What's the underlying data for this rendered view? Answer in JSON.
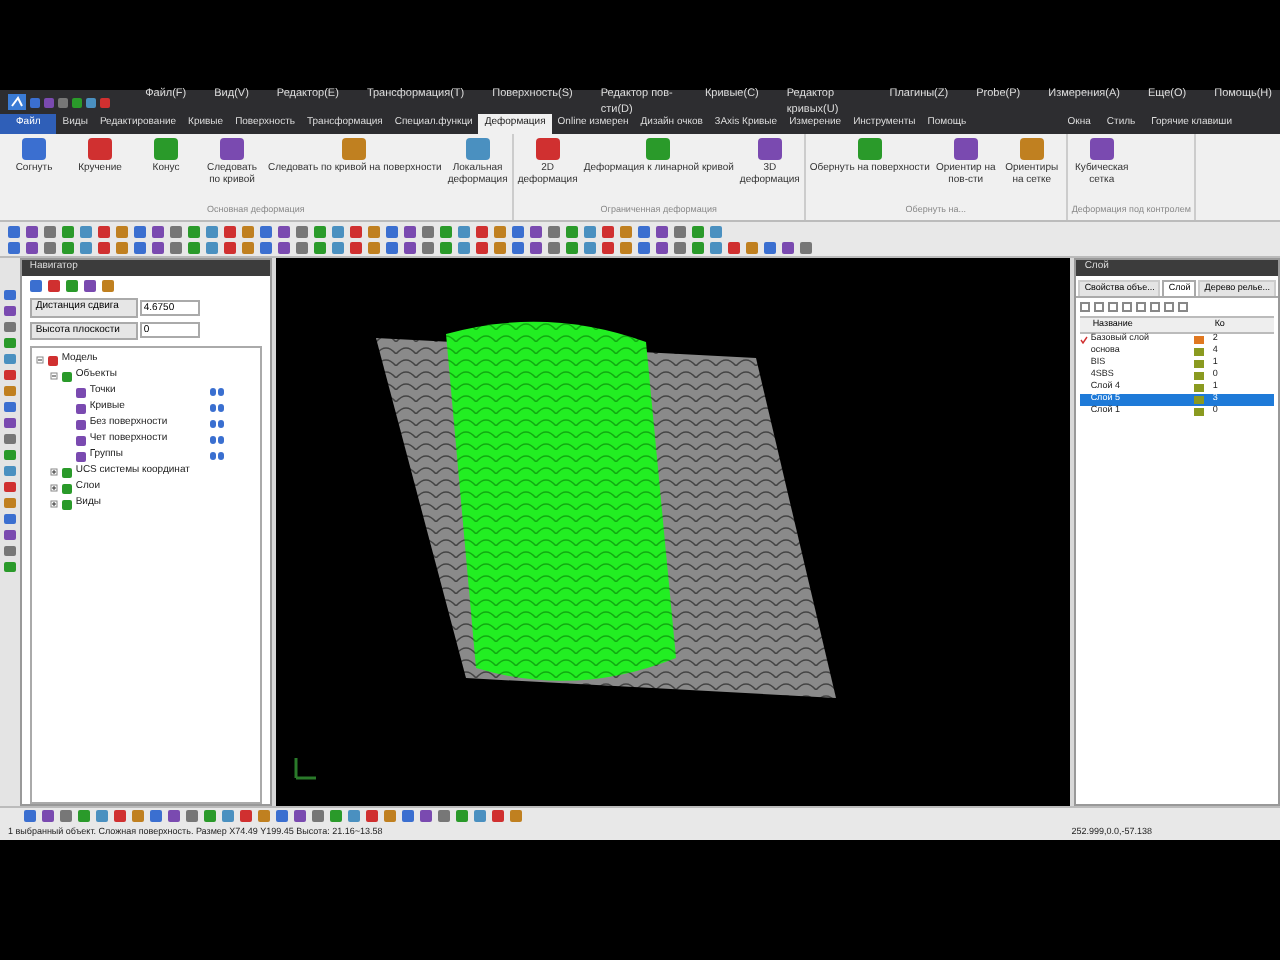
{
  "menu": [
    "Файл(F)",
    "Вид(V)",
    "Редактор(E)",
    "Трансформация(T)",
    "Поверхность(S)",
    "Редактор пов-сти(D)",
    "Кривые(C)",
    "Редактор кривых(U)",
    "Плагины(Z)",
    "Probe(P)",
    "Измерения(A)",
    "Еще(O)",
    "Помощь(H)"
  ],
  "ribbon_tabs": [
    {
      "label": "Файл",
      "kind": "file",
      "selected": false
    },
    {
      "label": "Виды",
      "kind": "tab",
      "selected": false
    },
    {
      "label": "Редактирование",
      "kind": "tab",
      "selected": false
    },
    {
      "label": "Кривые",
      "kind": "tab",
      "selected": false
    },
    {
      "label": "Поверхность",
      "kind": "tab",
      "selected": false
    },
    {
      "label": "Трансформация",
      "kind": "tab",
      "selected": false
    },
    {
      "label": "Специал.функци",
      "kind": "tab",
      "selected": false
    },
    {
      "label": "Деформация",
      "kind": "tab",
      "selected": true
    },
    {
      "label": "Online измерен",
      "kind": "tab",
      "selected": false
    },
    {
      "label": "Дизайн очков",
      "kind": "tab",
      "selected": false
    },
    {
      "label": "3Axis Кривые",
      "kind": "tab",
      "selected": false
    },
    {
      "label": "Измерение",
      "kind": "tab",
      "selected": false
    },
    {
      "label": "Инструменты",
      "kind": "tab",
      "selected": false
    },
    {
      "label": "Помощь",
      "kind": "tab",
      "selected": false
    }
  ],
  "ribbon_right": [
    "Окна",
    "Стиль",
    "Горячие клавиши"
  ],
  "ribbon_groups": [
    {
      "label": "Основная деформация",
      "buttons": [
        "Согнуть",
        "Кручение",
        "Конус",
        "Следовать по кривой",
        "Следовать по кривой на поверхности",
        "Локальная деформация"
      ]
    },
    {
      "label": "Ограниченная деформация",
      "buttons": [
        "2D деформация",
        "Деформация к линарной кривой",
        "3D деформация"
      ]
    },
    {
      "label": "Обернуть на...",
      "buttons": [
        "Обернуть на поверхности",
        "Ориентир на пов-сти",
        "Ориентиры на сетке"
      ]
    },
    {
      "label": "Деформация под контролем",
      "buttons": [
        "Кубическая сетка"
      ]
    }
  ],
  "navigator": {
    "title": "Навигатор",
    "fields": [
      {
        "label": "Дистанция сдвига",
        "value": "4.6750"
      },
      {
        "label": "Высота плоскости",
        "value": "0"
      }
    ],
    "tree": [
      {
        "label": "Модель",
        "expanded": true,
        "children": [
          {
            "label": "Объекты",
            "expanded": true,
            "children": [
              {
                "label": "Точки",
                "visible": true
              },
              {
                "label": "Кривые",
                "visible": true
              },
              {
                "label": "Без поверхности",
                "visible": true
              },
              {
                "label": "Чет поверхности",
                "visible": true
              },
              {
                "label": "Группы",
                "visible": true
              }
            ]
          },
          {
            "label": "UCS системы координат",
            "expanded": false
          },
          {
            "label": "Слои",
            "expanded": false
          },
          {
            "label": "Виды",
            "expanded": false
          }
        ]
      }
    ]
  },
  "layer_panel": {
    "title": "Слой",
    "tabs": [
      {
        "label": "Свойства объе...",
        "selected": false
      },
      {
        "label": "Слой",
        "selected": true
      },
      {
        "label": "Дерево релье...",
        "selected": false
      }
    ],
    "columns": [
      "Название",
      "Ко"
    ],
    "rows": [
      {
        "name": "Базовый слой",
        "current": true,
        "selected": false,
        "color": "#e07820",
        "count": "2"
      },
      {
        "name": "основа",
        "current": false,
        "selected": false,
        "color": "#8a9a20",
        "count": "4"
      },
      {
        "name": "BIS",
        "current": false,
        "selected": false,
        "color": "#8a9a20",
        "count": "1"
      },
      {
        "name": "4SBS",
        "current": false,
        "selected": false,
        "color": "#8a9a20",
        "count": "0"
      },
      {
        "name": "Слой 4",
        "current": false,
        "selected": false,
        "color": "#8a9a20",
        "count": "1"
      },
      {
        "name": "Слой 5",
        "current": false,
        "selected": true,
        "color": "#8a9a20",
        "count": "3"
      },
      {
        "name": "Слой 1",
        "current": false,
        "selected": false,
        "color": "#8a9a20",
        "count": "0"
      }
    ]
  },
  "status_bar": {
    "message": "1 выбранный объект. Сложная поверхность. Размер X74.49 Y199.45 Высота: 21.16~13.58",
    "coordinates": "252.999,0.0,-57.138"
  }
}
